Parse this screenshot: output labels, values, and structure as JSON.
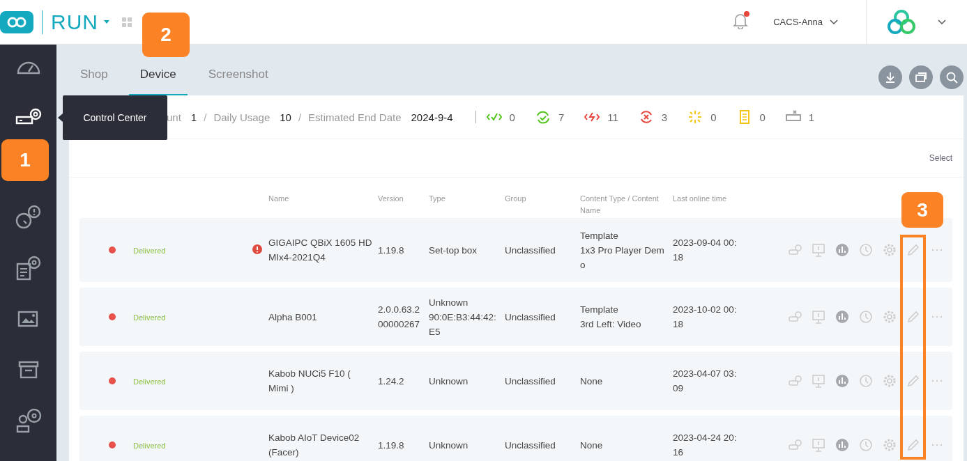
{
  "header": {
    "app_name": "RUN",
    "user": "CACS-Anna",
    "notification_unread": true
  },
  "sidebar": {
    "items": [
      {
        "selected": false
      },
      {
        "selected": true
      },
      {
        "selected": false
      },
      {
        "selected": false
      },
      {
        "selected": false
      },
      {
        "selected": false
      },
      {
        "selected": false
      }
    ],
    "tooltip": "Control Center"
  },
  "tabs": [
    {
      "label": "Shop",
      "selected": false
    },
    {
      "label": "Device",
      "selected": true
    },
    {
      "label": "Screenshot",
      "selected": false
    }
  ],
  "summary_separator": "/",
  "summary": [
    {
      "label": "unt",
      "value": "1"
    },
    {
      "label": "Daily Usage",
      "value": "10"
    },
    {
      "label": "Estimated End Date",
      "value": "2024-9-4"
    }
  ],
  "status_counts": [
    {
      "kind": "running",
      "color": "#52c41a",
      "value": "0"
    },
    {
      "kind": "synced",
      "color": "#52c41a",
      "value": "7"
    },
    {
      "kind": "error",
      "color": "#e8453c",
      "value": "11"
    },
    {
      "kind": "failed",
      "color": "#e8453c",
      "value": "3"
    },
    {
      "kind": "loading",
      "color": "#f5c518",
      "value": "0"
    },
    {
      "kind": "file",
      "color": "#f5c518",
      "value": "0"
    },
    {
      "kind": "offline",
      "color": "#a0a0a0",
      "value": "1"
    }
  ],
  "select_link": "Select",
  "table": {
    "columns": [
      "Name",
      "Version",
      "Type",
      "Group",
      "Content Type / Content Name",
      "Last online time"
    ],
    "rows": [
      {
        "color": "#e8524a",
        "status": "Delivered",
        "alert": true,
        "name": "GIGAIPC QBiX 1605 HD MIx4-2021Q4",
        "version": "1.19.8",
        "type": "Set-top box",
        "group": "Unclassified",
        "content_type": "Template",
        "content_name": "1x3 Pro Player Demo",
        "last_online": "2023-09-04 00:18"
      },
      {
        "color": "#e8524a",
        "status": "Delivered",
        "alert": false,
        "name": "Alpha B001",
        "version": "2.0.0.63.200000267",
        "type": "Unknown",
        "type_detail": "90:0E:B3:44:42:E5",
        "group": "Unclassified",
        "content_type": "Template",
        "content_name": "3rd Left: Video",
        "last_online": "2023-10-02 00:18"
      },
      {
        "color": "#e8524a",
        "status": "Delivered",
        "alert": false,
        "name": "Kabob NUCi5 F10 ( Mimi )",
        "version": "1.24.2",
        "type": "Unknown",
        "group": "Unclassified",
        "content_type": "None",
        "last_online": "2023-04-07 03:09"
      },
      {
        "color": "#e8524a",
        "status": "Delivered",
        "alert": false,
        "name": "Kabob AIoT Device02 (Facer)",
        "version": "1.19.8",
        "type": "Unknown",
        "group": "Unclassified",
        "content_type": "None",
        "last_online": "2023-04-24 20:16"
      }
    ]
  },
  "annotations": [
    {
      "kind": "callout",
      "label": "1"
    },
    {
      "kind": "callout",
      "label": "2"
    },
    {
      "kind": "callout",
      "label": "3"
    },
    {
      "kind": "frame"
    }
  ]
}
